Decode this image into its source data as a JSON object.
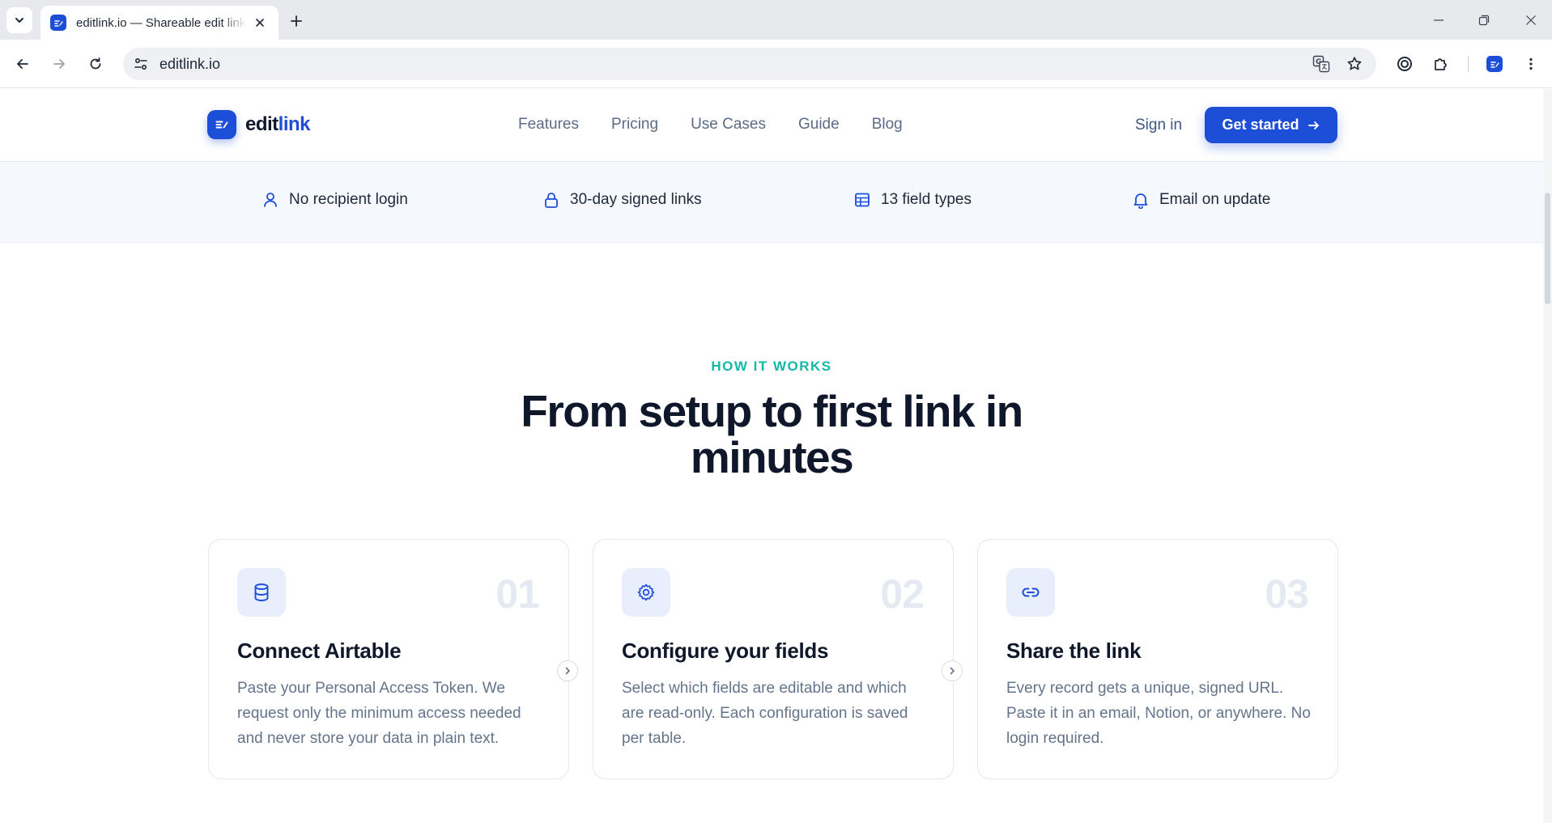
{
  "browser": {
    "tab_title": "editlink.io — Shareable edit links",
    "url": "editlink.io"
  },
  "site": {
    "logo": {
      "part1": "edit",
      "part2": "link"
    },
    "nav": [
      "Features",
      "Pricing",
      "Use Cases",
      "Guide",
      "Blog"
    ],
    "sign_in": "Sign in",
    "cta": "Get started"
  },
  "strip": [
    {
      "icon": "user-icon",
      "label": "No recipient login"
    },
    {
      "icon": "lock-icon",
      "label": "30-day signed links"
    },
    {
      "icon": "table-icon",
      "label": "13 field types"
    },
    {
      "icon": "bell-icon",
      "label": "Email on update"
    }
  ],
  "how": {
    "eyebrow": "HOW IT WORKS",
    "headline": "From setup to first link in minutes",
    "steps": [
      {
        "num": "01",
        "icon": "database-icon",
        "title": "Connect Airtable",
        "desc": "Paste your Personal Access Token. We request only the minimum access needed and never store your data in plain text."
      },
      {
        "num": "02",
        "icon": "gear-icon",
        "title": "Configure your fields",
        "desc": "Select which fields are editable and which are read-only. Each configuration is saved per table."
      },
      {
        "num": "03",
        "icon": "link-icon",
        "title": "Share the link",
        "desc": "Every record gets a unique, signed URL. Paste it in an email, Notion, or anywhere. No login required."
      }
    ]
  },
  "colors": {
    "brand": "#1d4ed8",
    "accent_teal": "#14b8a6",
    "text_dark": "#0f172a",
    "text_muted": "#64748b"
  }
}
